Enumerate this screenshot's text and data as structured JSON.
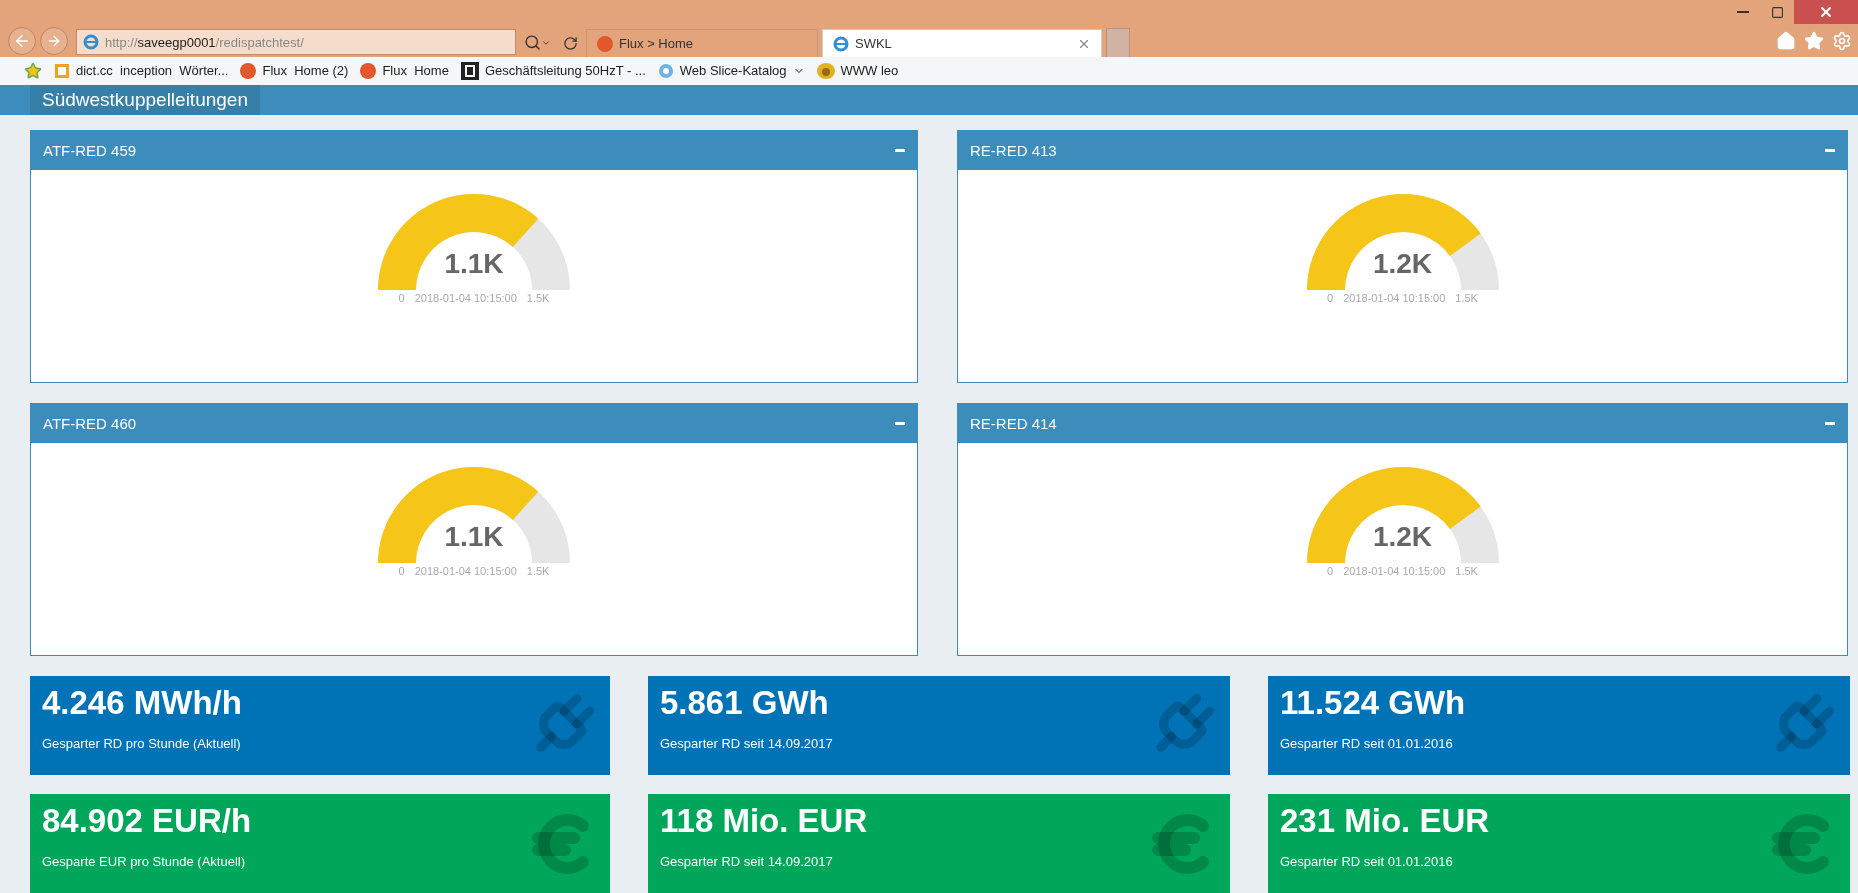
{
  "browser": {
    "address": "http://**saveegp0001**/redispatchtest/",
    "tabs": [
      {
        "label": "Flux > Home",
        "selected": false,
        "kind": "flux"
      },
      {
        "label": "SWKL",
        "selected": true,
        "kind": "ie"
      }
    ],
    "favorites": [
      {
        "label": "dict.cc  inception  Wörter...",
        "kind": "doc"
      },
      {
        "label": "Flux  Home (2)",
        "kind": "flux"
      },
      {
        "label": "Flux  Home",
        "kind": "flux"
      },
      {
        "label": "Geschäftsleitung 50HzT - ...",
        "kind": "b"
      },
      {
        "label": "Web Slice-Katalog",
        "kind": "slice"
      },
      {
        "label": "WWW leo",
        "kind": "leo"
      }
    ]
  },
  "header": {
    "title": "Südwestkuppelleitungen"
  },
  "panels": [
    {
      "title": "ATF-RED 459",
      "value": "1.1K",
      "min": "0",
      "max": "1.5K",
      "time": "2018-01-04 10:15:00"
    },
    {
      "title": "RE-RED 413",
      "value": "1.2K",
      "min": "0",
      "max": "1.5K",
      "time": "2018-01-04 10:15:00"
    },
    {
      "title": "ATF-RED 460",
      "value": "1.1K",
      "min": "0",
      "max": "1.5K",
      "time": "2018-01-04 10:15:00"
    },
    {
      "title": "RE-RED 414",
      "value": "1.2K",
      "min": "0",
      "max": "1.5K",
      "time": "2018-01-04 10:15:00"
    }
  ],
  "stats": [
    {
      "value": "4.246 MWh/h",
      "label": "Gesparter RD pro Stunde (Aktuell)",
      "kind": "energy"
    },
    {
      "value": "5.861 GWh",
      "label": "Gesparter RD seit 14.09.2017",
      "kind": "energy"
    },
    {
      "value": "11.524 GWh",
      "label": "Gesparter RD seit 01.01.2016",
      "kind": "energy"
    },
    {
      "value": "84.902 EUR/h",
      "label": "Gesparte EUR pro Stunde (Aktuell)",
      "kind": "money"
    },
    {
      "value": "118 Mio. EUR",
      "label": "Gesparter RD seit 14.09.2017",
      "kind": "money"
    },
    {
      "value": "231 Mio. EUR",
      "label": "Gesparter RD seit 01.01.2016",
      "kind": "money"
    }
  ]
}
